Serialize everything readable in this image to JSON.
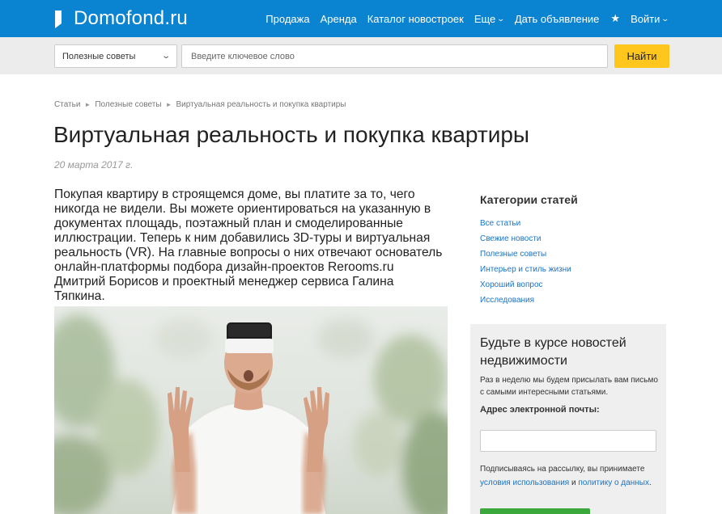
{
  "header": {
    "logo_text": "Domofond.ru",
    "nav": [
      {
        "label": "Продажа",
        "dropdown": false
      },
      {
        "label": "Аренда",
        "dropdown": false
      },
      {
        "label": "Каталог новостроек",
        "dropdown": false
      },
      {
        "label": "Еще",
        "dropdown": true
      },
      {
        "label": "Дать объявление",
        "dropdown": false
      }
    ],
    "favorite_icon": "star-icon",
    "login_label": "Войти",
    "colors": {
      "bar": "#0a84d0"
    }
  },
  "search": {
    "category_selected": "Полезные советы",
    "placeholder": "Введите ключевое слово",
    "button_label": "Найти",
    "button_color": "#ffc71d"
  },
  "breadcrumb": {
    "items": [
      "Статьи",
      "Полезные советы",
      "Виртуальная реальность и покупка квартиры"
    ]
  },
  "article": {
    "title": "Виртуальная реальность и покупка квартиры",
    "date": "20 марта 2017 г.",
    "lead": "Покупая квартиру в строящемся доме, вы платите за то, чего никогда не видели. Вы можете ориентироваться на указанную в документах площадь, поэтажный план и смоделированные иллюстрации. Теперь к ним добавились 3D-туры и виртуальная реальность (VR). На главные вопросы о них отвечают основатель онлайн-платформы подбора дизайн-проектов Rerooms.ru Дмитрий Борисов и проектный менеджер сервиса Галина Тяпкина."
  },
  "sidebar": {
    "categories_title": "Категории статей",
    "categories": [
      "Все статьи",
      "Свежие новости",
      "Полезные советы",
      "Интерьер и стиль жизни",
      "Хороший вопрос",
      "Исследования"
    ],
    "link_color": "#1a73c4"
  },
  "newsletter": {
    "title": "Будьте в курсе новостей недвижимости",
    "description": "Раз в неделю мы будем присылать вам письмо с самыми интересными статьями.",
    "email_label": "Адрес электронной почты:",
    "note_prefix": "Подписываясь на рассылку, вы принимаете",
    "terms_link": "условия использования",
    "note_and": "и",
    "privacy_link": "политику о данных",
    "note_suffix": "."
  }
}
